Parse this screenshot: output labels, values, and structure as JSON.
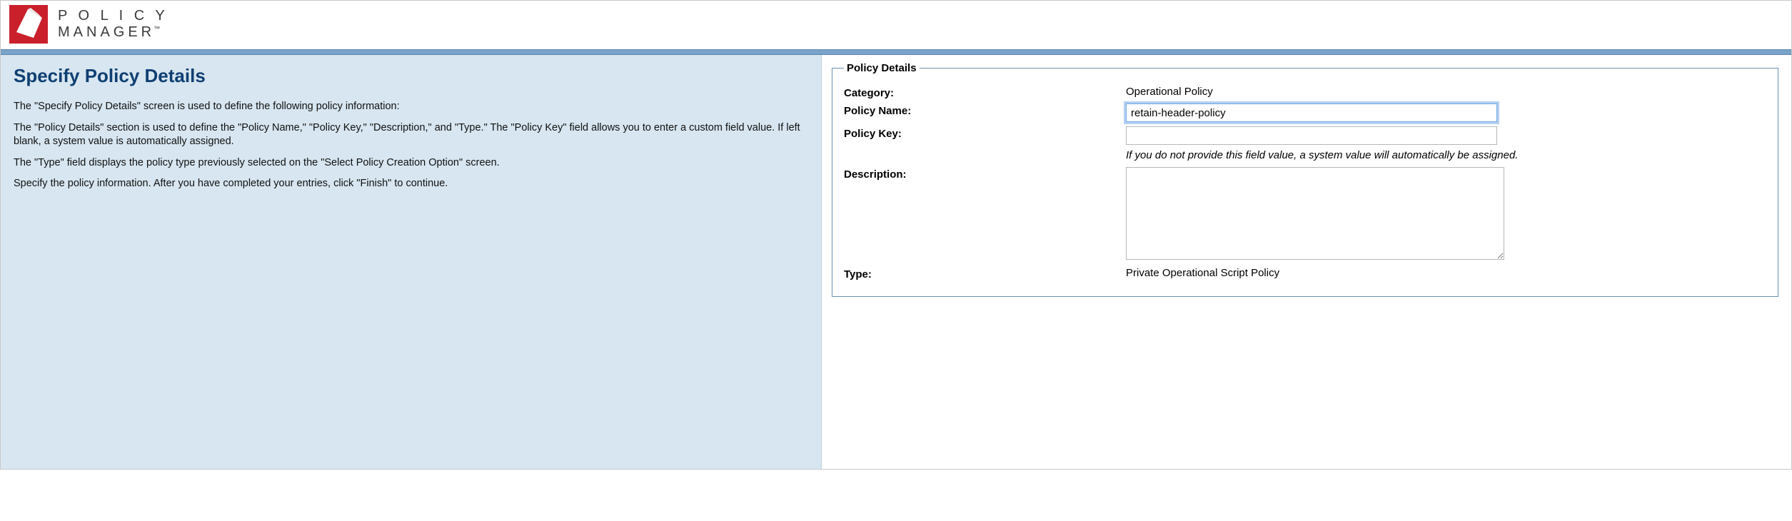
{
  "brand": {
    "line1": "P O L I C Y",
    "line2": "MANAGER",
    "tm": "™"
  },
  "left": {
    "title": "Specify Policy Details",
    "p1": "The \"Specify Policy Details\" screen is used to define the following policy information:",
    "p2": "The \"Policy Details\" section is used to define the \"Policy Name,\" \"Policy Key,\" \"Description,\" and \"Type.\" The \"Policy Key\" field allows you to enter a custom field value. If left blank, a system value is automatically assigned.",
    "p3": "The \"Type\" field displays the policy type previously selected on the \"Select Policy Creation Option\" screen.",
    "p4": "Specify the policy information. After you have completed your entries, click \"Finish\" to continue."
  },
  "form": {
    "legend": "Policy Details",
    "labels": {
      "category": "Category:",
      "policyName": "Policy Name:",
      "policyKey": "Policy Key:",
      "description": "Description:",
      "type": "Type:"
    },
    "values": {
      "category": "Operational Policy",
      "policyName": "retain-header-policy",
      "policyKey": "",
      "description": "",
      "type": "Private Operational Script Policy"
    },
    "hint": "If you do not provide this field value, a system value will automatically be assigned."
  }
}
